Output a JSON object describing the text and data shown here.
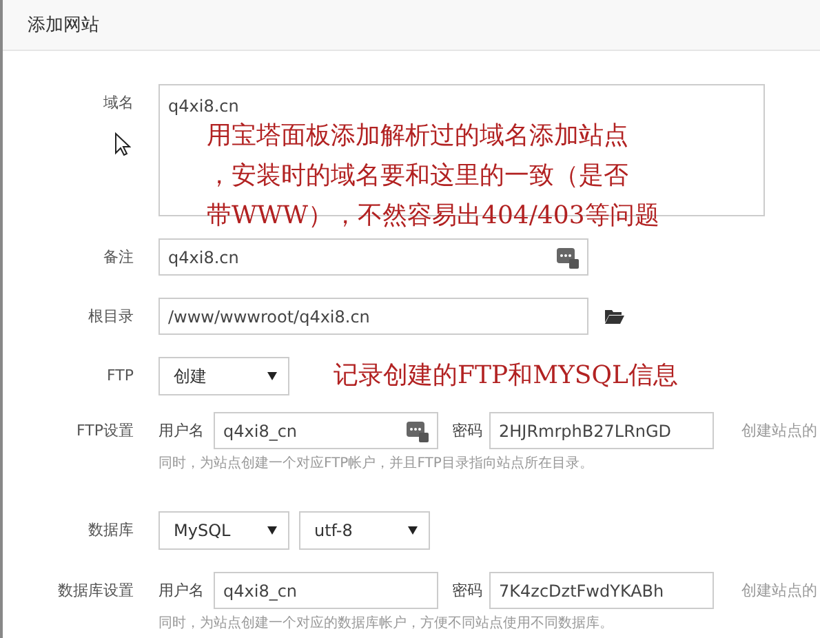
{
  "dialog": {
    "title": "添加网站"
  },
  "fields": [
    {
      "kind": "textarea",
      "label": "域名",
      "value": "q4xi8.cn"
    },
    {
      "kind": "input_badge",
      "label": "备注",
      "value": "q4xi8.cn"
    },
    {
      "kind": "input_folder",
      "label": "根目录",
      "value": "/www/wwwroot/q4xi8.cn"
    },
    {
      "kind": "select",
      "label": "FTP",
      "options": [
        "创建"
      ]
    },
    {
      "kind": "account",
      "label": "FTP设置",
      "user_label": "用户名",
      "user": "q4xi8_cn",
      "user_icon": true,
      "pass_label": "密码",
      "pass": "2HJRmrphB27LRnGD",
      "side_hint": "创建站点的",
      "hint": "同时，为站点创建一个对应FTP帐户，并且FTP目录指向站点所在目录。"
    },
    {
      "kind": "select",
      "label": "数据库",
      "options": [
        "MySQL",
        "utf-8"
      ]
    },
    {
      "kind": "account",
      "label": "数据库设置",
      "user_label": "用户名",
      "user": "q4xi8_cn",
      "user_icon": false,
      "pass_label": "密码",
      "pass": "7K4zcDztFwdYKABh",
      "side_hint": "创建站点的",
      "hint": "同时，为站点创建一个对应的数据库帐户，方便不同站点使用不同数据库。"
    }
  ],
  "annotations": [
    {
      "kind": "domain",
      "lines": [
        "用宝塔面板添加解析过的域名添加站点",
        "，安装时的域名要和这里的一致（是否",
        "带WWW），不然容易出404/403等问题"
      ]
    },
    {
      "kind": "ftp",
      "lines": [
        "记录创建的FTP和MYSQL信息"
      ]
    }
  ]
}
